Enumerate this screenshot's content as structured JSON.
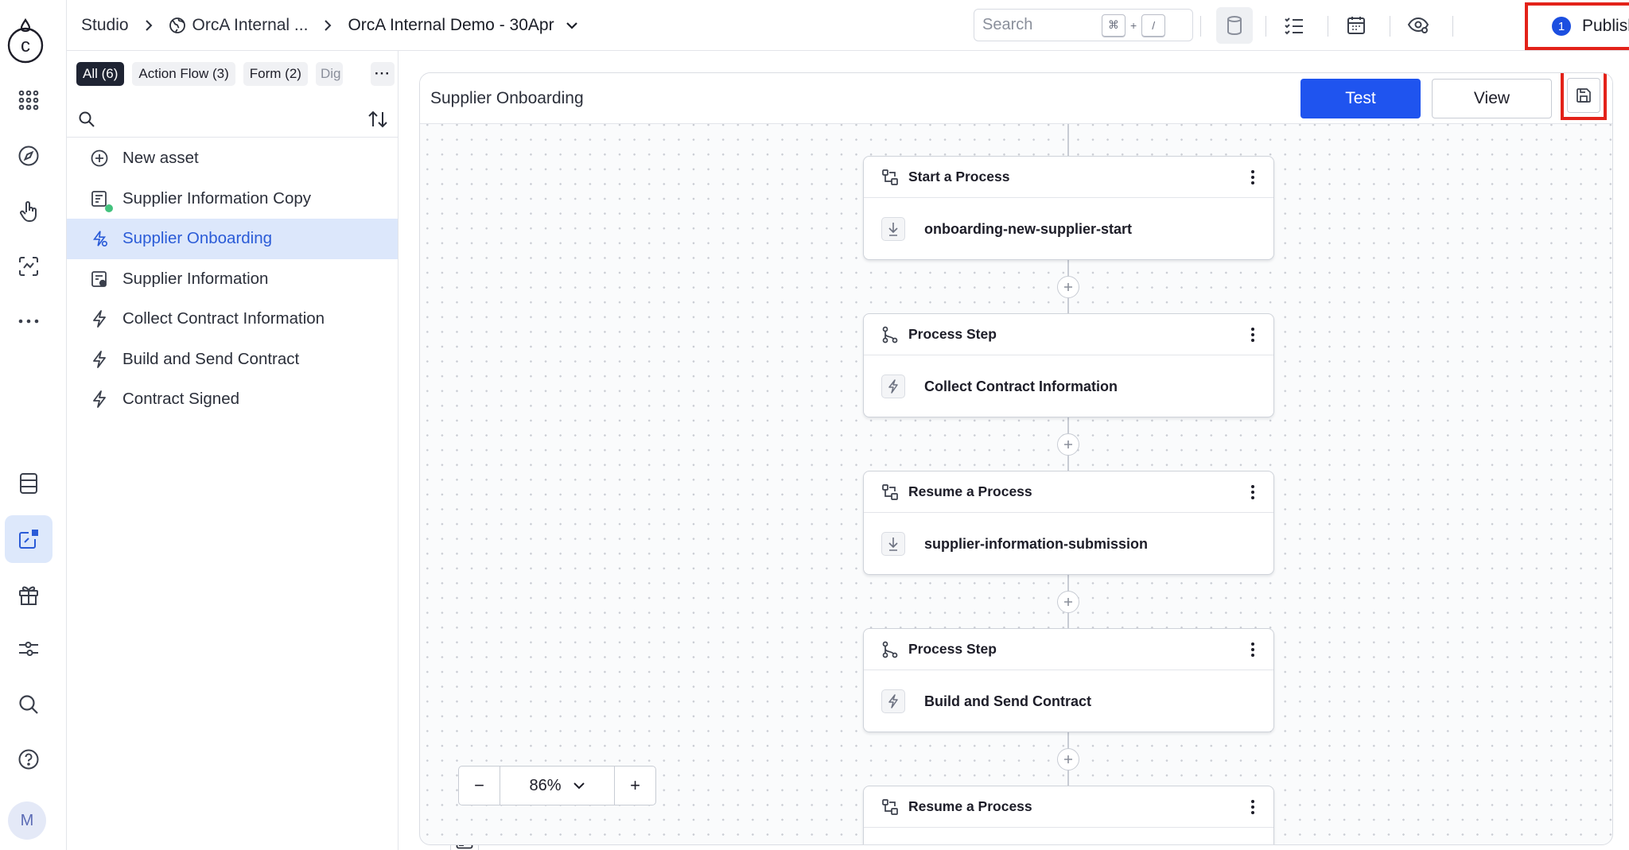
{
  "app": {
    "logo_letter": "c",
    "user_initial": "M"
  },
  "rail": {
    "items": [
      "apps-icon",
      "compass-icon",
      "touch-icon",
      "scan-icon",
      "more-icon",
      "database-icon",
      "assets-icon",
      "gift-icon",
      "sliders-icon",
      "search-icon",
      "help-icon"
    ],
    "active": "assets-icon"
  },
  "breadcrumb": {
    "root": "Studio",
    "workspace": "OrcA Internal ...",
    "project": "OrcA Internal Demo - 30Apr"
  },
  "search": {
    "placeholder": "Search",
    "shortcut_key1": "⌘",
    "shortcut_plus": "+",
    "shortcut_key2": "/"
  },
  "publish": {
    "count": "1",
    "label": "Publish"
  },
  "filters": [
    {
      "label": "All (6)",
      "active": true
    },
    {
      "label": "Action Flow (3)",
      "active": false
    },
    {
      "label": "Form (2)",
      "active": false
    },
    {
      "label": "Dig",
      "active": false
    }
  ],
  "filters_more": "···",
  "assets": [
    {
      "label": "New asset",
      "icon": "plus-circle-icon"
    },
    {
      "label": "Supplier Information Copy",
      "icon": "form-icon"
    },
    {
      "label": "Supplier Onboarding",
      "icon": "process-icon",
      "selected": true
    },
    {
      "label": "Supplier Information",
      "icon": "form-settings-icon"
    },
    {
      "label": "Collect Contract Information",
      "icon": "lightning-icon"
    },
    {
      "label": "Build and Send Contract",
      "icon": "lightning-icon"
    },
    {
      "label": "Contract Signed",
      "icon": "lightning-icon"
    }
  ],
  "canvas": {
    "title": "Supplier Onboarding",
    "test_label": "Test",
    "view_label": "View",
    "zoom_minus": "−",
    "zoom_plus": "+",
    "zoom_value": "86%",
    "nodes": [
      {
        "type": "Start a Process",
        "name": "onboarding-new-supplier-start",
        "head_icon": "flow-start-icon",
        "body_icon": "download-arrow-icon"
      },
      {
        "type": "Process Step",
        "name": "Collect Contract Information",
        "head_icon": "branch-icon",
        "body_icon": "lightning-icon"
      },
      {
        "type": "Resume a Process",
        "name": "supplier-information-submission",
        "head_icon": "flow-start-icon",
        "body_icon": "download-arrow-icon"
      },
      {
        "type": "Process Step",
        "name": "Build and Send Contract",
        "head_icon": "branch-icon",
        "body_icon": "lightning-icon"
      },
      {
        "type": "Resume a Process",
        "name": "",
        "head_icon": "flow-start-icon",
        "body_icon": "download-arrow-icon"
      }
    ]
  },
  "colors": {
    "accent": "#1f54ef",
    "highlight": "#e32219",
    "selected_bg": "#dce7fb",
    "selected_text": "#2a5bd7"
  }
}
